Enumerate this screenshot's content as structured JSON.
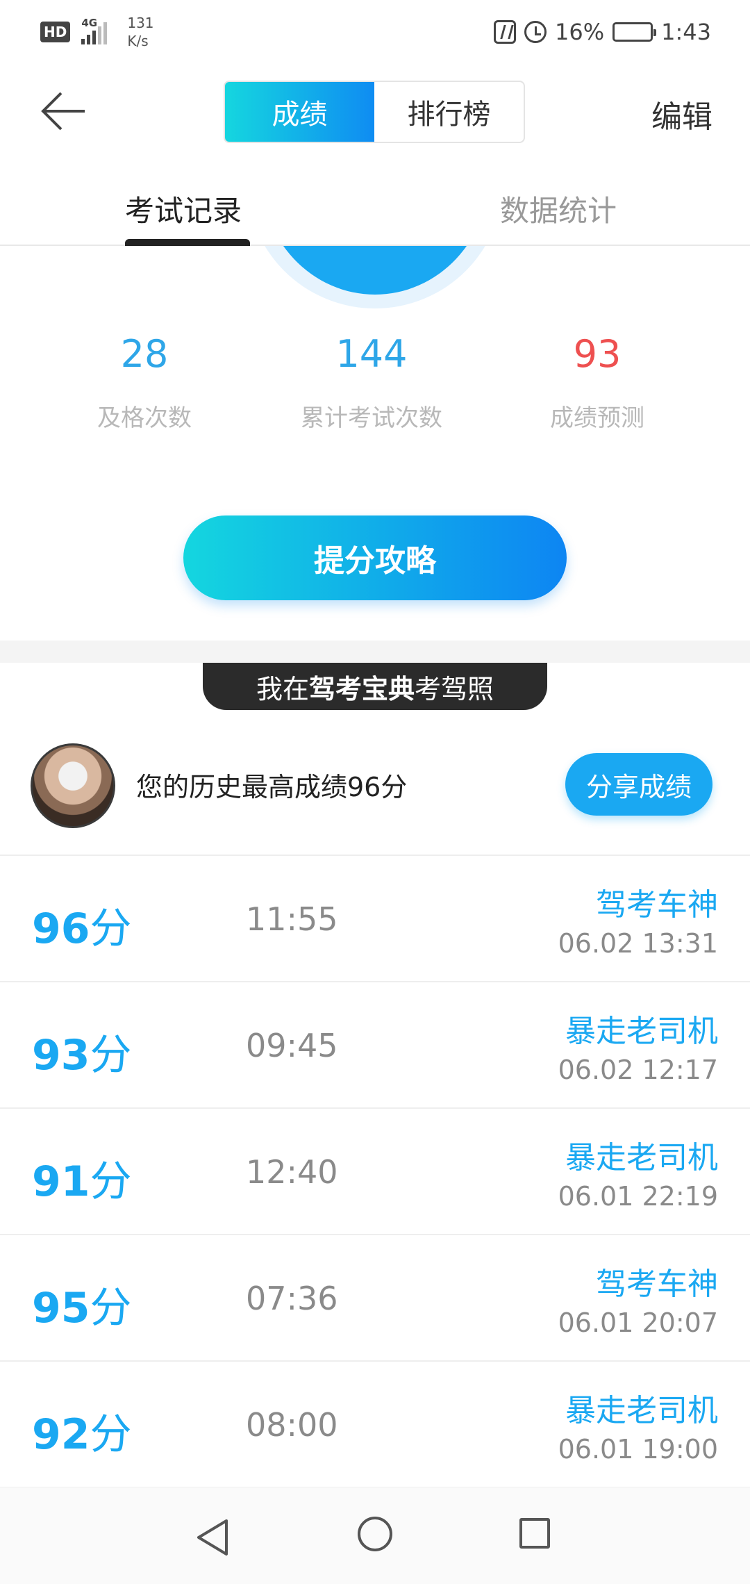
{
  "status_bar": {
    "hd": "HD",
    "network": "4G",
    "speed_value": "131",
    "speed_unit": "K/s",
    "battery": "16%",
    "time": "1:43"
  },
  "header": {
    "segments": [
      "成绩",
      "排行榜"
    ],
    "active_segment": "成绩",
    "edit_label": "编辑"
  },
  "tabs": {
    "records": "考试记录",
    "stats": "数据统计"
  },
  "stats": [
    {
      "value": "28",
      "label": "及格次数"
    },
    {
      "value": "144",
      "label": "累计考试次数"
    },
    {
      "value": "93",
      "label": "成绩预测"
    }
  ],
  "tips_button": "提分攻略",
  "banner": {
    "prefix": "我在",
    "brand": "驾考宝典",
    "suffix": "考驾照"
  },
  "best": {
    "text": "您的历史最高成绩96分",
    "share_label": "分享成绩"
  },
  "records": [
    {
      "score": "96",
      "unit": "分",
      "duration": "11:55",
      "title": "驾考车神",
      "date": "06.02  13:31"
    },
    {
      "score": "93",
      "unit": "分",
      "duration": "09:45",
      "title": "暴走老司机",
      "date": "06.02  12:17"
    },
    {
      "score": "91",
      "unit": "分",
      "duration": "12:40",
      "title": "暴走老司机",
      "date": "06.01  22:19"
    },
    {
      "score": "95",
      "unit": "分",
      "duration": "07:36",
      "title": "驾考车神",
      "date": "06.01  20:07"
    },
    {
      "score": "92",
      "unit": "分",
      "duration": "08:00",
      "title": "暴走老司机",
      "date": "06.01  19:00"
    }
  ],
  "colors": {
    "accent": "#1aa8f2",
    "gradient_start": "#14d6df",
    "gradient_end": "#0d85f3",
    "prediction": "#ee5050"
  },
  "battery_level": 0.16
}
